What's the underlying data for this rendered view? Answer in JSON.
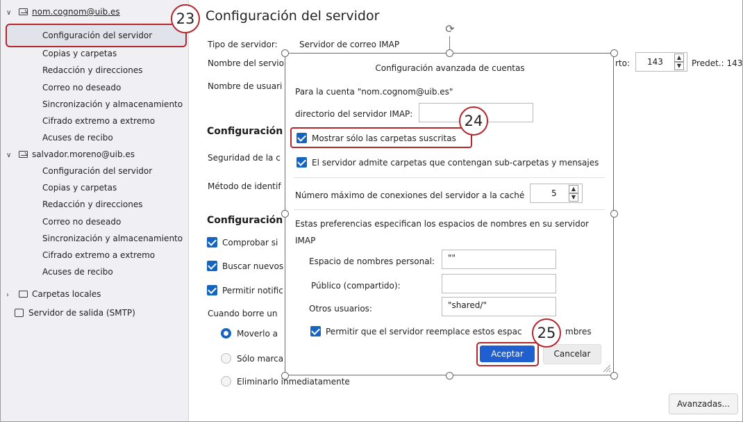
{
  "sidebar": {
    "account1": "nom.cognom@uib.es",
    "account1_items": [
      "Configuración del servidor",
      "Copias y carpetas",
      "Redacción y direcciones",
      "Correo no deseado",
      "Sincronización y almacenamiento",
      "Cifrado extremo a extremo",
      "Acuses de recibo"
    ],
    "account2": "salvador.moreno@uib.es",
    "account2_items": [
      "Configuración del servidor",
      "Copias y carpetas",
      "Redacción y direcciones",
      "Correo no deseado",
      "Sincronización y almacenamiento",
      "Cifrado extremo a extremo",
      "Acuses de recibo"
    ],
    "local_folders": "Carpetas locales",
    "smtp": "Servidor de salida (SMTP)"
  },
  "main": {
    "title": "Configuración del servidor",
    "server_type_label": "Tipo de servidor:",
    "server_type_value": "Servidor de correo IMAP",
    "server_name_label": "Nombre del servio",
    "port_label": "rto:",
    "port_value": "143",
    "default_label": "Predet.: 143",
    "username_label": "Nombre de usuari",
    "section_security": "Configuración d",
    "security_label": "Seguridad de la c",
    "auth_label": "Método de identif",
    "section_server": "Configuración d",
    "check_new": "Comprobar si",
    "fetch_new": "Buscar nuevos",
    "allow_notif": "Permitir notific",
    "on_delete": "Cuando borre un",
    "move_to": "Moverlo a",
    "mark_only": "Sólo marca",
    "delete_now": "Eliminarlo inmediatamente",
    "advanced_button": "Avanzadas..."
  },
  "dialog": {
    "title": "Configuración avanzada de cuentas",
    "account_line": "Para la cuenta \"nom.cognom@uib.es\"",
    "imap_dir_label": "directorio del servidor IMAP:",
    "imap_dir_value": "",
    "show_subscribed": "Mostrar sólo las carpetas suscritas",
    "supports_sub": "El servidor admite carpetas que contengan sub-carpetas y mensajes",
    "max_conn_label": "Número máximo de conexiones del servidor a la caché",
    "max_conn_value": "5",
    "ns_desc_1": "Estas preferencias especifican los espacios de nombres en su servidor",
    "ns_desc_2": "IMAP",
    "personal_label": "Espacio de nombres personal:",
    "personal_value": "\"\"",
    "public_label": "Público (compartido):",
    "public_value": "",
    "others_label": "Otros usuarios:",
    "others_value": "\"shared/\"",
    "allow_override_a": "Permitir que el servidor reemplace estos espac",
    "allow_override_b": "mbres",
    "accept": "Aceptar",
    "cancel": "Cancelar"
  },
  "badges": {
    "b23": "23",
    "b24": "24",
    "b25": "25"
  }
}
